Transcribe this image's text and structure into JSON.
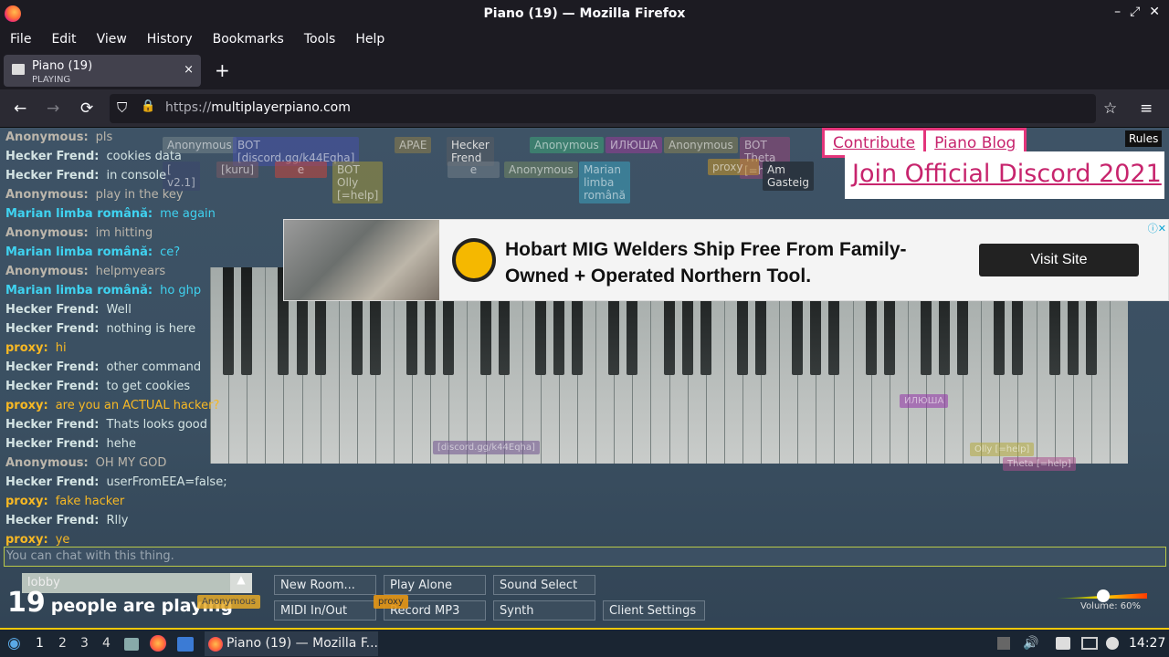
{
  "window": {
    "title": "Piano (19) — Mozilla Firefox",
    "controls": [
      "–",
      "⤢",
      "✕"
    ]
  },
  "menu": [
    "File",
    "Edit",
    "View",
    "History",
    "Bookmarks",
    "Tools",
    "Help"
  ],
  "tab": {
    "title": "Piano (19)",
    "status": "PLAYING",
    "close": "×",
    "new": "+"
  },
  "nav": {
    "back": "←",
    "forward": "→",
    "reload": "⟳",
    "shield": "⛉",
    "lock": "🔒",
    "url_scheme": "https://",
    "url_host": "multiplayerpiano.com",
    "star": "☆",
    "menu": "≡"
  },
  "links": {
    "contribute": "Contribute",
    "blog": "Piano Blog",
    "discord": "Join Official Discord 2021",
    "rules": "Rules"
  },
  "ad": {
    "headline": "Hobart MIG Welders Ship Free From Family-Owned + Operated Northern Tool.",
    "cta": "Visit Site",
    "close": "ⓘ✕"
  },
  "players": [
    {
      "name": "Anonymous"
    },
    {
      "name": "BOT [discord.gg/k44Eqha]"
    },
    {
      "name": "APAE"
    },
    {
      "name": "Hecker Frend"
    },
    {
      "name": "Anonymous"
    },
    {
      "name": "ИЛЮША"
    },
    {
      "name": "Anonymous"
    },
    {
      "name": "BOT Theta [=help]"
    },
    {
      "name": "[ v2.1]"
    },
    {
      "name": "[kuru]"
    },
    {
      "name": "e"
    },
    {
      "name": "BOT Olly [=help]"
    },
    {
      "name": "e"
    },
    {
      "name": "Anonymous"
    },
    {
      "name": "Marian limba română"
    },
    {
      "name": "proxy"
    },
    {
      "name": "Am Gasteig"
    }
  ],
  "chat": [
    {
      "name": "Anonymous:",
      "text": "pls",
      "cls": "c2"
    },
    {
      "name": "Hecker Frend:",
      "text": "cookies data",
      "cls": "c1"
    },
    {
      "name": "Hecker Frend:",
      "text": "in console",
      "cls": "c1"
    },
    {
      "name": "Anonymous:",
      "text": "play in the key",
      "cls": "c2"
    },
    {
      "name": "Marian limba română:",
      "text": "me again",
      "cls": "c3"
    },
    {
      "name": "Anonymous:",
      "text": "im hitting",
      "cls": "c2"
    },
    {
      "name": "Marian limba română:",
      "text": "ce?",
      "cls": "c3"
    },
    {
      "name": "Anonymous:",
      "text": "helpmyears",
      "cls": "c2"
    },
    {
      "name": "Marian limba română:",
      "text": "ho ghp",
      "cls": "c3"
    },
    {
      "name": "Hecker Frend:",
      "text": "Well",
      "cls": "c1"
    },
    {
      "name": "Hecker Frend:",
      "text": "nothing is here",
      "cls": "c1"
    },
    {
      "name": "proxy:",
      "text": "hi",
      "cls": "c4"
    },
    {
      "name": "Hecker Frend:",
      "text": "other command",
      "cls": "c1"
    },
    {
      "name": "Hecker Frend:",
      "text": "to get cookies",
      "cls": "c1"
    },
    {
      "name": "proxy:",
      "text": "are you an ACTUAL hacker?",
      "cls": "c4"
    },
    {
      "name": "Hecker Frend:",
      "text": "Thats looks good",
      "cls": "c1"
    },
    {
      "name": "Hecker Frend:",
      "text": "hehe",
      "cls": "c1"
    },
    {
      "name": "Anonymous:",
      "text": "OH MY GOD",
      "cls": "c2"
    },
    {
      "name": "Hecker Frend:",
      "text": "userFromEEA=false;",
      "cls": "c1"
    },
    {
      "name": "proxy:",
      "text": "fake hacker",
      "cls": "c4"
    },
    {
      "name": "Hecker Frend:",
      "text": "Rlly",
      "cls": "c1"
    },
    {
      "name": "proxy:",
      "text": "ye",
      "cls": "c4"
    }
  ],
  "chat_placeholder": "You can chat with this thing.",
  "cursor_labels": [
    "Anonymous",
    "ИЛЮША",
    "[discord.gg/k44Eqha]",
    "Olly [=help]",
    "Theta [=help]",
    "Anonymous",
    "proxy"
  ],
  "room": {
    "name": "lobby",
    "count": "19",
    "count_label": "people are playing",
    "arrow": "▲"
  },
  "buttons": [
    "New Room...",
    "Play Alone",
    "Sound Select",
    "MIDI In/Out",
    "Record MP3",
    "Synth",
    "Client Settings"
  ],
  "volume": {
    "label": "Volume: 60%",
    "level": 0.6
  },
  "taskbar": {
    "workspaces": [
      "1",
      "2",
      "3",
      "4"
    ],
    "app_title": "Piano (19) — Mozilla F...",
    "clock": "14:27"
  },
  "colors": {
    "accent": "#e3357b",
    "taskbar_border": "#f5c80a"
  }
}
